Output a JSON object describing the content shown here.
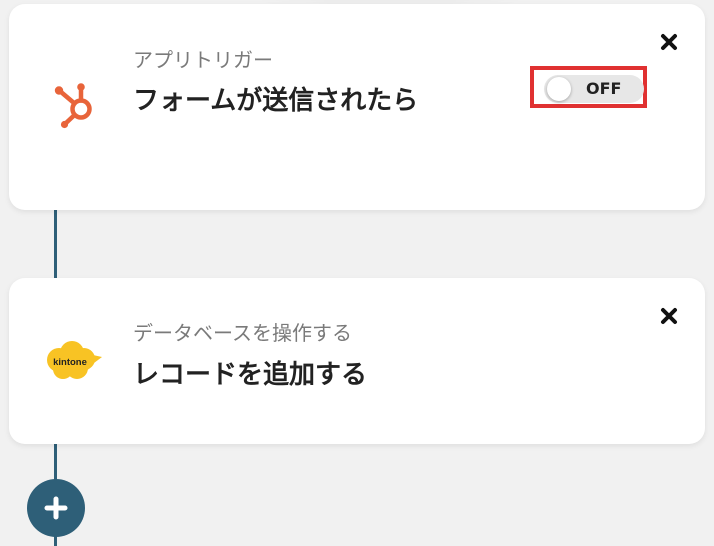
{
  "flow": {
    "steps": [
      {
        "label": "アプリトリガー",
        "title": "フォームが送信されたら",
        "app_icon": "hubspot-icon",
        "toggle": {
          "state_label": "OFF",
          "on": false
        },
        "close_icon": "close-icon"
      },
      {
        "label": "データベースを操作する",
        "title": "レコードを追加する",
        "app_icon": "kintone-icon",
        "app_icon_text": "kintone",
        "close_icon": "close-icon"
      }
    ],
    "add_step_icon": "plus-icon"
  },
  "colors": {
    "background": "#f1f1f1",
    "card": "#ffffff",
    "connector": "#2e5f78",
    "add_button": "#2e5f78",
    "highlight": "#e03131",
    "hubspot": "#e8643a",
    "kintone": "#f8c324"
  }
}
